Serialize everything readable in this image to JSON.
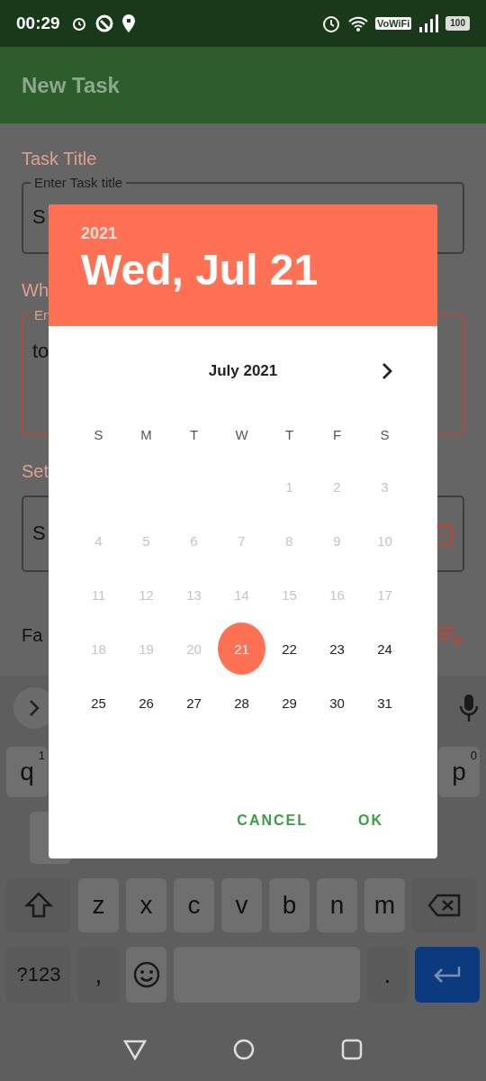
{
  "status_bar": {
    "time": "00:29",
    "vowifi": "VoWiFi",
    "battery": "100"
  },
  "app_bar": {
    "title": "New Task"
  },
  "form": {
    "title_label": "Task Title",
    "title_field": {
      "legend": "Enter Task title",
      "value": "S",
      "focused": false
    },
    "what_label": "Wh",
    "what_field": {
      "legend": "En",
      "value": "to",
      "focused": true
    },
    "set_label": "Set",
    "date_field": {
      "value": "S",
      "focused": false
    },
    "fa_label": "Fa"
  },
  "keyboard": {
    "row1": [
      {
        "label": "q",
        "hint": "1"
      },
      {
        "label": "p",
        "hint": "0"
      }
    ],
    "row3": [
      "z",
      "x",
      "c",
      "v",
      "b",
      "n",
      "m"
    ],
    "row4": {
      "symbols": "?123",
      "comma": ",",
      "period": "."
    }
  },
  "date_picker": {
    "year": "2021",
    "date": "Wed, Jul 21",
    "month": "July 2021",
    "weekdays": [
      "S",
      "M",
      "T",
      "W",
      "T",
      "F",
      "S"
    ],
    "weeks": [
      [
        {
          "kind": "blank"
        },
        {
          "kind": "blank"
        },
        {
          "kind": "blank"
        },
        {
          "kind": "blank"
        },
        {
          "kind": "day",
          "day": "1",
          "disabled": true,
          "selected": false
        },
        {
          "kind": "day",
          "day": "2",
          "disabled": true,
          "selected": false
        },
        {
          "kind": "day",
          "day": "3",
          "disabled": true,
          "selected": false
        }
      ],
      [
        {
          "kind": "day",
          "day": "4",
          "disabled": true,
          "selected": false
        },
        {
          "kind": "day",
          "day": "5",
          "disabled": true,
          "selected": false
        },
        {
          "kind": "day",
          "day": "6",
          "disabled": true,
          "selected": false
        },
        {
          "kind": "day",
          "day": "7",
          "disabled": true,
          "selected": false
        },
        {
          "kind": "day",
          "day": "8",
          "disabled": true,
          "selected": false
        },
        {
          "kind": "day",
          "day": "9",
          "disabled": true,
          "selected": false
        },
        {
          "kind": "day",
          "day": "10",
          "disabled": true,
          "selected": false
        }
      ],
      [
        {
          "kind": "day",
          "day": "11",
          "disabled": true,
          "selected": false
        },
        {
          "kind": "day",
          "day": "12",
          "disabled": true,
          "selected": false
        },
        {
          "kind": "day",
          "day": "13",
          "disabled": true,
          "selected": false
        },
        {
          "kind": "day",
          "day": "14",
          "disabled": true,
          "selected": false
        },
        {
          "kind": "day",
          "day": "15",
          "disabled": true,
          "selected": false
        },
        {
          "kind": "day",
          "day": "16",
          "disabled": true,
          "selected": false
        },
        {
          "kind": "day",
          "day": "17",
          "disabled": true,
          "selected": false
        }
      ],
      [
        {
          "kind": "day",
          "day": "18",
          "disabled": true,
          "selected": false
        },
        {
          "kind": "day",
          "day": "19",
          "disabled": true,
          "selected": false
        },
        {
          "kind": "day",
          "day": "20",
          "disabled": true,
          "selected": false
        },
        {
          "kind": "day",
          "day": "21",
          "disabled": false,
          "selected": true
        },
        {
          "kind": "day",
          "day": "22",
          "disabled": false,
          "selected": false
        },
        {
          "kind": "day",
          "day": "23",
          "disabled": false,
          "selected": false
        },
        {
          "kind": "day",
          "day": "24",
          "disabled": false,
          "selected": false
        }
      ],
      [
        {
          "kind": "day",
          "day": "25",
          "disabled": false,
          "selected": false
        },
        {
          "kind": "day",
          "day": "26",
          "disabled": false,
          "selected": false
        },
        {
          "kind": "day",
          "day": "27",
          "disabled": false,
          "selected": false
        },
        {
          "kind": "day",
          "day": "28",
          "disabled": false,
          "selected": false
        },
        {
          "kind": "day",
          "day": "29",
          "disabled": false,
          "selected": false
        },
        {
          "kind": "day",
          "day": "30",
          "disabled": false,
          "selected": false
        },
        {
          "kind": "day",
          "day": "31",
          "disabled": false,
          "selected": false
        }
      ]
    ],
    "buttons": [
      "CANCEL",
      "OK"
    ]
  }
}
